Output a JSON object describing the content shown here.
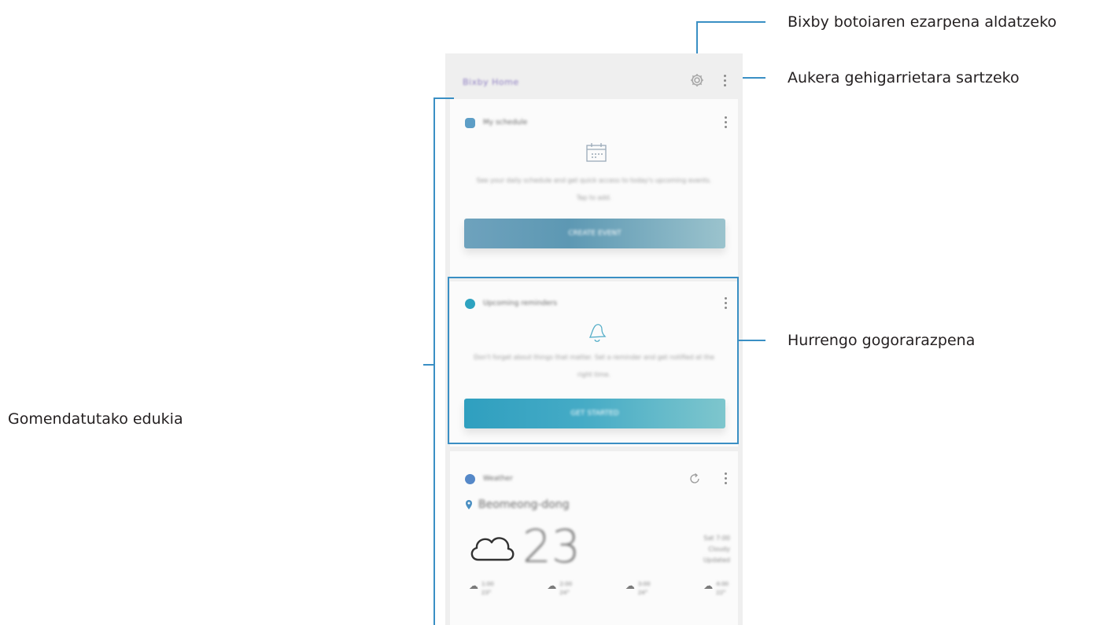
{
  "callouts": {
    "settings": "Bixby botoiaren ezarpena aldatzeko",
    "more_options": "Aukera gehigarrietara sartzeko",
    "next_reminder": "Hurrengo gogorarazpena",
    "recommended": "Gomendatutako edukia"
  },
  "screen": {
    "brand": "Bixby Home",
    "cards": [
      {
        "title": "My schedule",
        "description": "See your daily schedule and get quick access to today's upcoming events. Tap to add.",
        "button": "CREATE EVENT"
      },
      {
        "title": "Upcoming reminders",
        "description": "Don't forget about things that matter. Set a reminder and get notified at the right time.",
        "button": "GET STARTED"
      },
      {
        "title": "Weather",
        "location": "Beomeong-dong",
        "temperature": "23",
        "detail_lines": [
          "Sat 7:00",
          "Cloudy",
          "Updated"
        ],
        "forecast": [
          {
            "time": "1:00",
            "temp": "23°"
          },
          {
            "time": "2:00",
            "temp": "24°"
          },
          {
            "time": "3:00",
            "temp": "24°"
          },
          {
            "time": "4:00",
            "temp": "22°"
          }
        ]
      }
    ]
  },
  "colors": {
    "leader_line": "#3a8fc4",
    "highlight_border": "#3a8fc4",
    "brand": "#8f7fc2",
    "button_1": "#6ea2bd",
    "button_2": "#2f9fbf"
  }
}
